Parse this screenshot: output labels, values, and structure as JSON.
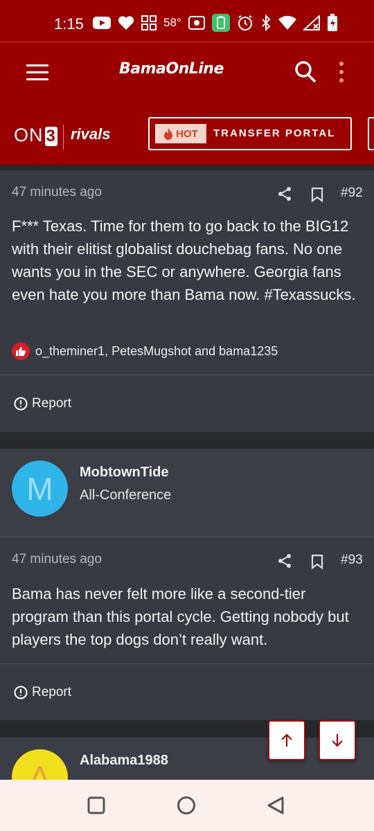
{
  "status_bar": {
    "time": "1:15",
    "temperature": "58°",
    "icons": [
      "youtube-icon",
      "heart-icon",
      "grid-icon",
      "temperature-icon",
      "radio-icon",
      "battery-saver-icon",
      "alarm-icon",
      "bluetooth-icon",
      "wifi-icon",
      "signal-icon",
      "battery-icon"
    ]
  },
  "app_bar": {
    "logo": "BamaOnLine",
    "menu_icon": "hamburger-icon",
    "search_icon": "search-icon",
    "more_icon": "more-vertical-icon"
  },
  "brand_bar": {
    "on3_text": "ON",
    "on3_digit": "3",
    "rivals": "rivals",
    "hot_label": "HOT",
    "portal_label": "TRANSFER PORTAL"
  },
  "posts": [
    {
      "timestamp": "47 minutes ago",
      "number": "#92",
      "body": "F*** Texas. Time for them to go back to the BIG12 with their elitist globalist douchebag fans. No one wants you in the SEC or anywhere. Georgia fans even hate you more than Bama now. #Texassucks.",
      "reactions": "o_theminer1, PetesMugshot and bama1235",
      "report": "Report"
    },
    {
      "timestamp": "47 minutes ago",
      "number": "#93",
      "body": "Bama has never felt more like a second-tier program than this portal cycle. Getting nobody but players the top dogs don’t really want.",
      "report": "Report"
    }
  ],
  "users": [
    {
      "initial": "M",
      "name": "MobtownTide",
      "title": "All-Conference",
      "color": "#2fb4ea"
    },
    {
      "initial": "A",
      "name": "Alabama1988",
      "title": "",
      "color": "#f3e01c"
    }
  ],
  "colors": {
    "brand": "#9b0000",
    "post_bg": "#373a40",
    "page_bg": "#26282c"
  }
}
